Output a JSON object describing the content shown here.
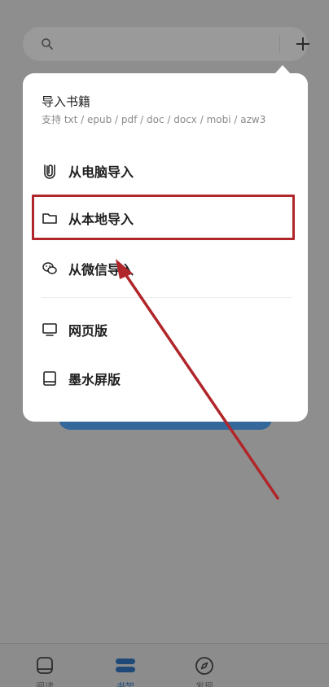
{
  "popup": {
    "title": "导入书籍",
    "subtitle": "支持 txt / epub / pdf / doc / docx / mobi / azw3",
    "items": [
      {
        "label": "从电脑导入",
        "icon": "paperclip-icon"
      },
      {
        "label": "从本地导入",
        "icon": "folder-icon"
      },
      {
        "label": "从微信导入",
        "icon": "wechat-icon"
      },
      {
        "label": "网页版",
        "icon": "monitor-icon"
      },
      {
        "label": "墨水屏版",
        "icon": "tablet-icon"
      }
    ]
  },
  "nav": {
    "items": [
      {
        "label": "阅读",
        "icon": "tablet-outline-icon"
      },
      {
        "label": "书架",
        "icon": "bookshelf-icon"
      },
      {
        "label": "发现",
        "icon": "compass-icon"
      }
    ]
  },
  "colors": {
    "overlay": "#8e8e8e",
    "highlight": "#b0262a",
    "accent_blue": "#34689a"
  }
}
